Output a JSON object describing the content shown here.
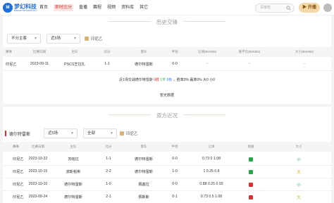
{
  "nav": {
    "logo_text": "梦幻科技",
    "logo_sub": "DREAM TECHNOLOGY",
    "logo_mark": "M",
    "items": [
      "首页",
      "即时比分",
      "直播",
      "赛程",
      "视频",
      "资料库",
      "其它"
    ],
    "active_index": 1,
    "search_placeholder": "百家姓",
    "open_label": "开播"
  },
  "history": {
    "title": "历史交锋",
    "filter_home": "不分主客",
    "filter_count": "近5场",
    "checkbox_label": "印尼乙",
    "columns": [
      "赛事",
      "比赛日期",
      "主队",
      "比分",
      "客队",
      "半场",
      "让球(Bet365)",
      "胜平负(Bet365)",
      "大小(Bet365)"
    ],
    "rows": [
      {
        "league": "印尼乙",
        "date": "2023-09-11",
        "home": "PSCS芝拉扎",
        "score": "1-1",
        "away": "德尔特雷斯",
        "half": "0-0",
        "handicap": "-",
        "odds": "-",
        "ou": "-"
      }
    ],
    "summary_prefix": "近1场交战德尔特雷斯",
    "summary_win": "0胜",
    "summary_draw": "1平",
    "summary_lose": "0负",
    "summary_rest": "，胜率0% 赢率0% 大0 小0",
    "no_more": "暂无数据"
  },
  "recent": {
    "title": "双方近况",
    "team": "德尔特雷斯",
    "filter_count": "近5场",
    "filter_scope": "全部",
    "checkbox_label": "印尼乙",
    "columns": [
      "赛事",
      "比赛日期",
      "主队",
      "比分",
      "客队",
      "半场",
      "让球",
      "盘路",
      "大小"
    ],
    "rows": [
      {
        "league": "印尼乙",
        "date": "2023-10-22",
        "home": "苏帕拉",
        "score": "1-1",
        "away": "德尔特雷斯",
        "half": "0-0",
        "handicap": "0.73 0 1.08",
        "result": "平",
        "ou": "小"
      },
      {
        "league": "印尼乙",
        "date": "2023-10-15",
        "home": "波斯帕希",
        "score": "2-2",
        "away": "德尔特雷斯",
        "half": "1-0",
        "handicap": "1 0.25 0.8",
        "result": "平",
        "ou": "大"
      },
      {
        "league": "印尼乙",
        "date": "2023-10-10",
        "home": "德尔特雷斯",
        "score": "1-0",
        "away": "佩塞拉",
        "half": "0-0",
        "handicap": "0.88 0.25 0.93",
        "result": "赢",
        "ou": "小"
      },
      {
        "league": "印尼乙",
        "date": "2023-09-24",
        "home": "德尔特雷斯",
        "score": "2-1",
        "away": "佩斯斯",
        "half": "0-1",
        "handicap": "0.73 0.5 1.08",
        "result": "赢",
        "ou": "大"
      }
    ]
  },
  "colors": {
    "accent": "#e0302d",
    "gold": "#d7b57a",
    "win": "#e0302d",
    "draw": "#28a745",
    "big": "#d4a017",
    "small": "#28a745"
  }
}
